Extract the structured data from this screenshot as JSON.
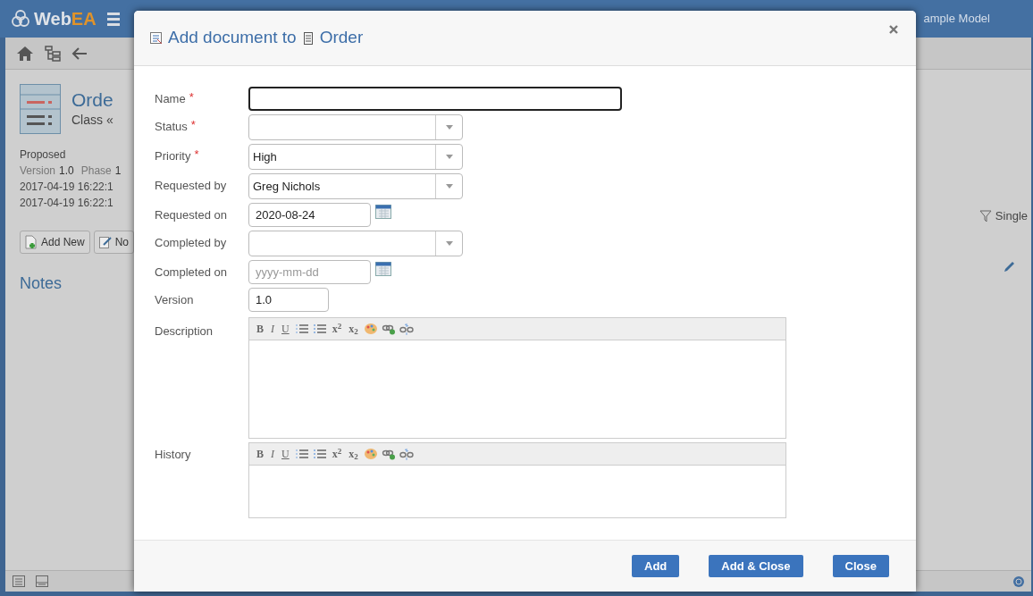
{
  "app": {
    "logo_prefix": "Web",
    "logo_suffix": "EA",
    "model_name": "ample Model"
  },
  "element": {
    "name": "Orde",
    "type": "Class «",
    "status": "Proposed",
    "version_label": "Version",
    "version": "1.0",
    "phase_label": "Phase",
    "phase": "1",
    "created": "2017-04-19 16:22:1",
    "modified": "2017-04-19 16:22:1"
  },
  "actions": [
    {
      "label": "Add New",
      "kind": "add"
    },
    {
      "label": "No",
      "kind": "note"
    }
  ],
  "section_title": "Notes",
  "filter_label": "Single",
  "dialog": {
    "title_prefix": "Add document to",
    "title_target": "Order",
    "fields": [
      {
        "label": "Name",
        "required_mark": "*",
        "kind": "text",
        "focused": true
      },
      {
        "label": "Status",
        "required_mark": "*",
        "kind": "select"
      },
      {
        "label": "Priority",
        "required_mark": "*",
        "kind": "select",
        "value": "High"
      },
      {
        "label": "Requested by",
        "kind": "select",
        "value": "Greg Nichols"
      },
      {
        "label": "Requested on",
        "kind": "date",
        "value": "2020-08-24"
      },
      {
        "label": "Completed by",
        "kind": "select"
      },
      {
        "label": "Completed on",
        "kind": "date",
        "placeholder": "yyyy-mm-dd"
      },
      {
        "label": "Version",
        "kind": "short",
        "value": "1.0"
      },
      {
        "label": "Description",
        "kind": "editor",
        "toolbar": [
          {
            "kind": "bold",
            "label": "B"
          },
          {
            "kind": "italic",
            "label": "I"
          },
          {
            "kind": "underline",
            "label": "U"
          },
          {
            "kind": "ordered-list"
          },
          {
            "kind": "bullet-list"
          },
          {
            "kind": "superscript",
            "label": "x$^{2}$"
          },
          {
            "kind": "subscript",
            "label": "x$_{2}$"
          },
          {
            "kind": "palette"
          },
          {
            "kind": "link"
          },
          {
            "kind": "unlink"
          }
        ]
      },
      {
        "label": "History",
        "kind": "memo",
        "toolbar": [
          {
            "kind": "bold",
            "label": "B"
          },
          {
            "kind": "italic",
            "label": "I"
          },
          {
            "kind": "underline",
            "label": "U"
          },
          {
            "kind": "ordered-list"
          },
          {
            "kind": "bullet-list"
          },
          {
            "kind": "superscript",
            "label": "x$^{2}$"
          },
          {
            "kind": "subscript",
            "label": "x$_{2}$"
          },
          {
            "kind": "palette"
          },
          {
            "kind": "link"
          },
          {
            "kind": "unlink"
          }
        ]
      }
    ],
    "buttons": [
      "Add",
      "Add & Close",
      "Close"
    ]
  }
}
